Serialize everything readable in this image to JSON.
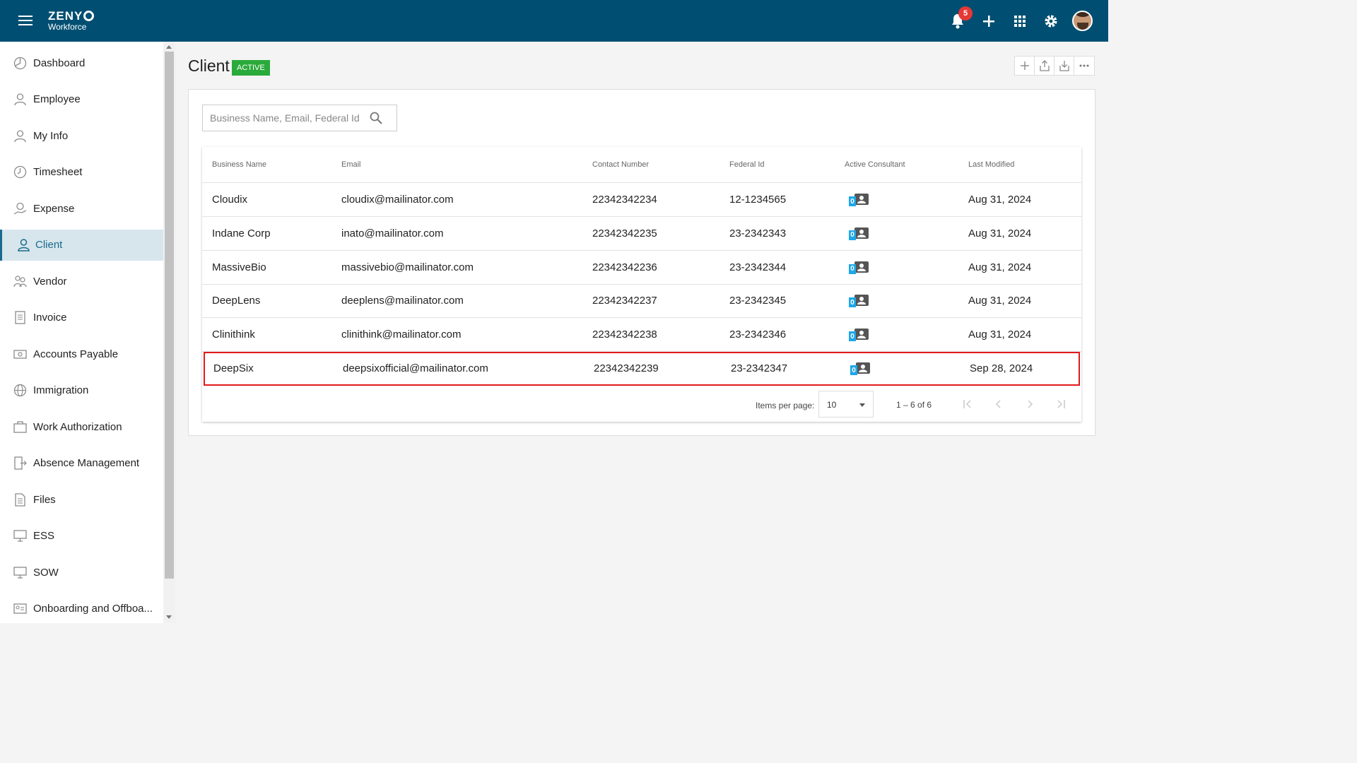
{
  "app": {
    "logo_brand": "ZENY",
    "logo_sub": "Workforce",
    "notifications_count": "5"
  },
  "sidebar": {
    "items": [
      {
        "label": "Dashboard",
        "icon": "dashboard-icon"
      },
      {
        "label": "Employee",
        "icon": "employee-icon"
      },
      {
        "label": "My Info",
        "icon": "my-info-icon"
      },
      {
        "label": "Timesheet",
        "icon": "clock-icon"
      },
      {
        "label": "Expense",
        "icon": "expense-icon"
      },
      {
        "label": "Client",
        "icon": "person-icon",
        "active": true
      },
      {
        "label": "Vendor",
        "icon": "vendor-icon"
      },
      {
        "label": "Invoice",
        "icon": "invoice-icon"
      },
      {
        "label": "Accounts Payable",
        "icon": "accounts-payable-icon"
      },
      {
        "label": "Immigration",
        "icon": "globe-icon"
      },
      {
        "label": "Work Authorization",
        "icon": "briefcase-icon"
      },
      {
        "label": "Absence Management",
        "icon": "door-exit-icon"
      },
      {
        "label": "Files",
        "icon": "file-icon"
      },
      {
        "label": "ESS",
        "icon": "ess-icon"
      },
      {
        "label": "SOW",
        "icon": "sow-icon"
      },
      {
        "label": "Onboarding and Offboa...",
        "icon": "id-card-icon"
      }
    ]
  },
  "page": {
    "title": "Client",
    "status": "ACTIVE"
  },
  "search": {
    "placeholder": "Business Name, Email, Federal Id",
    "value": ""
  },
  "table": {
    "columns": [
      "Business Name",
      "Email",
      "Contact Number",
      "Federal Id",
      "Active Consultant",
      "Last Modified"
    ],
    "rows": [
      {
        "name": "Cloudix",
        "email": "cloudix@mailinator.com",
        "contact": "22342342234",
        "federal_id": "12-1234565",
        "consultants": "0",
        "modified": "Aug 31, 2024"
      },
      {
        "name": "Indane Corp",
        "email": "inato@mailinator.com",
        "contact": "22342342235",
        "federal_id": "23-2342343",
        "consultants": "0",
        "modified": "Aug 31, 2024"
      },
      {
        "name": "MassiveBio",
        "email": "massivebio@mailinator.com",
        "contact": "22342342236",
        "federal_id": "23-2342344",
        "consultants": "0",
        "modified": "Aug 31, 2024"
      },
      {
        "name": "DeepLens",
        "email": "deeplens@mailinator.com",
        "contact": "22342342237",
        "federal_id": "23-2342345",
        "consultants": "0",
        "modified": "Aug 31, 2024"
      },
      {
        "name": "Clinithink",
        "email": "clinithink@mailinator.com",
        "contact": "22342342238",
        "federal_id": "23-2342346",
        "consultants": "0",
        "modified": "Aug 31, 2024"
      },
      {
        "name": "DeepSix",
        "email": "deepsixofficial@mailinator.com",
        "contact": "22342342239",
        "federal_id": "23-2342347",
        "consultants": "0",
        "modified": "Sep 28, 2024",
        "highlighted": true
      }
    ]
  },
  "paginator": {
    "items_per_page_label": "Items per page:",
    "items_per_page": "10",
    "range": "1 – 6 of 6"
  },
  "colors": {
    "topbar": "#004f72",
    "active_badge": "#2aaa3a",
    "highlight_border": "#e21b1b",
    "consultant_badge": "#1ea7e8"
  }
}
